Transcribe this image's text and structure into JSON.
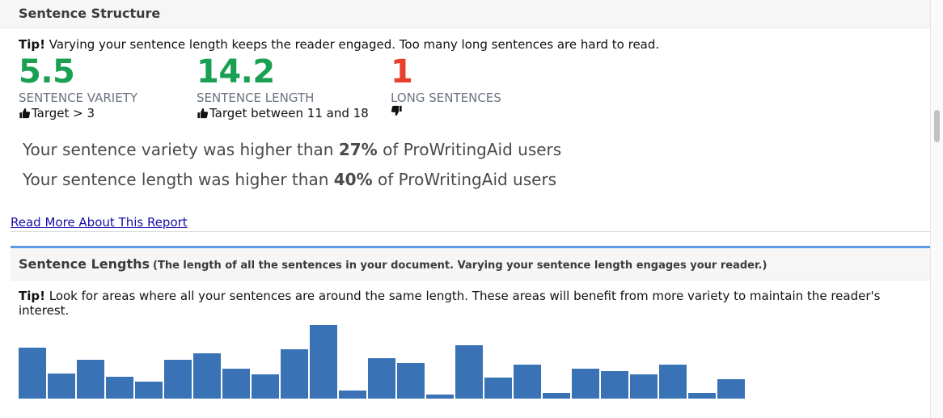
{
  "structure": {
    "title": "Sentence Structure",
    "tip_bold": "Tip!",
    "tip_text": " Varying your sentence length keeps the reader engaged. Too many long sentences are hard to read."
  },
  "metrics": [
    {
      "value": "5.5",
      "label": "SENTENCE VARIETY",
      "target": "Target > 3",
      "color": "#1aa053",
      "thumb": "up"
    },
    {
      "value": "14.2",
      "label": "SENTENCE LENGTH",
      "target": "Target between 11 and 18",
      "color": "#1aa053",
      "thumb": "up"
    },
    {
      "value": "1",
      "label": "LONG SENTENCES",
      "target": "",
      "color": "#e8402c",
      "thumb": "down"
    }
  ],
  "stats": [
    {
      "pre": "Your sentence variety was higher than ",
      "pct": "27%",
      "post": " of ProWritingAid users"
    },
    {
      "pre": "Your sentence length was higher than ",
      "pct": "40%",
      "post": " of ProWritingAid users"
    }
  ],
  "read_more": "Read More About This Report",
  "lengths": {
    "title": "Sentence Lengths",
    "subtitle": "(The length of all the sentences in your document. Varying your sentence length engages your reader.)",
    "tip_bold": "Tip!",
    "tip_text": " Look for areas where all your sentences are around the same length. These areas will benefit from more variety to maintain the reader's interest."
  },
  "chart_data": {
    "type": "bar",
    "color": "#3a73b5",
    "values": [
      62,
      31,
      47,
      27,
      21,
      47,
      55,
      37,
      30,
      60,
      90,
      10,
      49,
      44,
      5,
      65,
      26,
      42,
      7,
      37,
      34,
      30,
      42,
      7,
      24
    ]
  }
}
